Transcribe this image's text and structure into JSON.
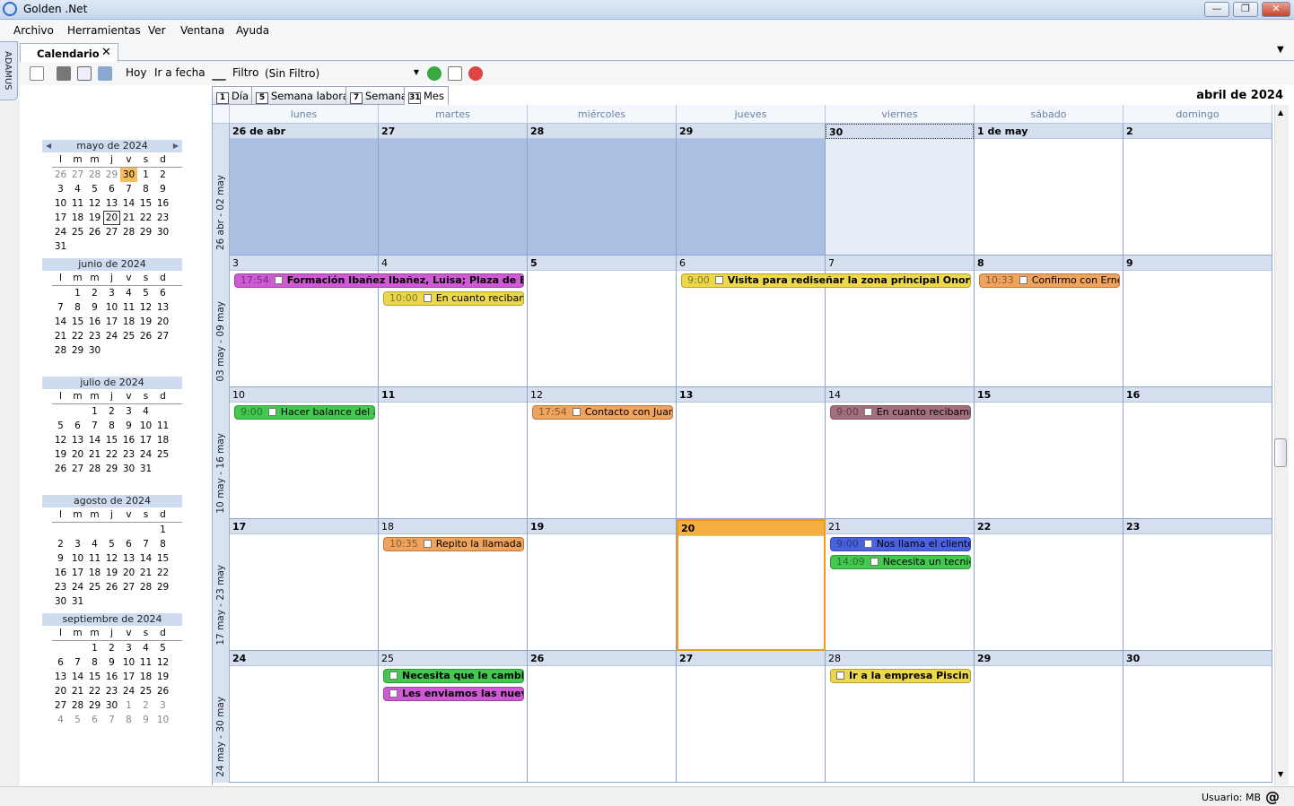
{
  "window": {
    "title": "Golden .Net",
    "min": "—",
    "max": "❐",
    "close": "✕"
  },
  "menu": [
    "Archivo",
    "Herramientas",
    "Ver",
    "Ventana",
    "Ayuda"
  ],
  "sidebar_label": "ADAMUS",
  "tab": {
    "label": "Calendario",
    "close": "✕",
    "dropdown": "▼"
  },
  "toolbar": {
    "today": "Hoy",
    "goto": "Ir a fecha",
    "filter_label": "Filtro",
    "filter_value": "(Sin Filtro)"
  },
  "view_tabs": [
    {
      "num": "1",
      "label": "Día"
    },
    {
      "num": "5",
      "label": "Semana laboral"
    },
    {
      "num": "7",
      "label": "Semana"
    },
    {
      "num": "31",
      "label": "Mes"
    }
  ],
  "period": "abril de 2024",
  "mini_calendars": [
    {
      "title": "mayo de 2024",
      "dow": [
        "l",
        "m",
        "m",
        "j",
        "v",
        "s",
        "d"
      ],
      "weeks": [
        [
          "26",
          "27",
          "28",
          "29",
          "30",
          "1",
          "2"
        ],
        [
          "3",
          "4",
          "5",
          "6",
          "7",
          "8",
          "9"
        ],
        [
          "10",
          "11",
          "12",
          "13",
          "14",
          "15",
          "16"
        ],
        [
          "17",
          "18",
          "19",
          "20",
          "21",
          "22",
          "23"
        ],
        [
          "24",
          "25",
          "26",
          "27",
          "28",
          "29",
          "30"
        ],
        [
          "31"
        ]
      ]
    },
    {
      "title": "junio de 2024",
      "dow": [
        "l",
        "m",
        "m",
        "j",
        "v",
        "s",
        "d"
      ],
      "weeks": [
        [
          "",
          "1",
          "2",
          "3",
          "4",
          "5",
          "6"
        ],
        [
          "7",
          "8",
          "9",
          "10",
          "11",
          "12",
          "13"
        ],
        [
          "14",
          "15",
          "16",
          "17",
          "18",
          "19",
          "20"
        ],
        [
          "21",
          "22",
          "23",
          "24",
          "25",
          "26",
          "27"
        ],
        [
          "28",
          "29",
          "30"
        ]
      ]
    },
    {
      "title": "julio de 2024",
      "dow": [
        "l",
        "m",
        "m",
        "j",
        "v",
        "s",
        "d"
      ],
      "weeks": [
        [
          "",
          "",
          "1",
          "2",
          "3",
          "4"
        ],
        [
          "5",
          "6",
          "7",
          "8",
          "9",
          "10",
          "11"
        ],
        [
          "12",
          "13",
          "14",
          "15",
          "16",
          "17",
          "18"
        ],
        [
          "19",
          "20",
          "21",
          "22",
          "23",
          "24",
          "25"
        ],
        [
          "26",
          "27",
          "28",
          "29",
          "30",
          "31"
        ]
      ]
    },
    {
      "title": "agosto de 2024",
      "dow": [
        "l",
        "m",
        "m",
        "j",
        "v",
        "s",
        "d"
      ],
      "weeks": [
        [
          "",
          "",
          "",
          "",
          "",
          "",
          "1"
        ],
        [
          "2",
          "3",
          "4",
          "5",
          "6",
          "7",
          "8"
        ],
        [
          "9",
          "10",
          "11",
          "12",
          "13",
          "14",
          "15"
        ],
        [
          "16",
          "17",
          "18",
          "19",
          "20",
          "21",
          "22"
        ],
        [
          "23",
          "24",
          "25",
          "26",
          "27",
          "28",
          "29"
        ],
        [
          "30",
          "31"
        ]
      ]
    },
    {
      "title": "septiembre de 2024",
      "dow": [
        "l",
        "m",
        "m",
        "j",
        "v",
        "s",
        "d"
      ],
      "weeks": [
        [
          "",
          "",
          "1",
          "2",
          "3",
          "4",
          "5"
        ],
        [
          "6",
          "7",
          "8",
          "9",
          "10",
          "11",
          "12"
        ],
        [
          "13",
          "14",
          "15",
          "16",
          "17",
          "18",
          "19"
        ],
        [
          "20",
          "21",
          "22",
          "23",
          "24",
          "25",
          "26"
        ],
        [
          "27",
          "28",
          "29",
          "30",
          "1",
          "2",
          "3"
        ],
        [
          "4",
          "5",
          "6",
          "7",
          "8",
          "9",
          "10"
        ]
      ]
    }
  ],
  "days_of_week": [
    "lunes",
    "martes",
    "miércoles",
    "jueves",
    "viernes",
    "sábado",
    "domingo"
  ],
  "weeks": [
    {
      "label": "26 abr - 02 may",
      "days": [
        "26 de abr",
        "27",
        "28",
        "29",
        "30",
        "1 de may",
        "2"
      ]
    },
    {
      "label": "03 may - 09 may",
      "days": [
        "3",
        "4",
        "5",
        "6",
        "7",
        "8",
        "9"
      ]
    },
    {
      "label": "10 may - 16 may",
      "days": [
        "10",
        "11",
        "12",
        "13",
        "14",
        "15",
        "16"
      ]
    },
    {
      "label": "17 may - 23 may",
      "days": [
        "17",
        "18",
        "19",
        "20",
        "21",
        "22",
        "23"
      ]
    },
    {
      "label": "24 may - 30 may",
      "days": [
        "24",
        "25",
        "26",
        "27",
        "28",
        "29",
        "30"
      ]
    }
  ],
  "events": [
    {
      "week": 1,
      "col": 0,
      "span": 2,
      "row": 0,
      "time": "17:54",
      "text": "Formación Ibañez Ibañez, Luisa;   Plaza de Esp",
      "color": "#d05ad6",
      "bold": true
    },
    {
      "week": 1,
      "col": 1,
      "span": 1,
      "row": 1,
      "time": "10:00",
      "text": "En cuanto recibam",
      "color": "#ecd84a"
    },
    {
      "week": 1,
      "col": 3,
      "span": 2,
      "row": 0,
      "time": "9:00",
      "text": "Visita para rediseñar la zona principal Onorio",
      "color": "#ecd84a",
      "bold": true
    },
    {
      "week": 1,
      "col": 5,
      "span": 1,
      "row": 0,
      "time": "10:33",
      "text": "Confirmo con Erne",
      "color": "#f0a35c"
    },
    {
      "week": 2,
      "col": 0,
      "span": 1,
      "row": 0,
      "time": "9:00",
      "text": "Hacer balance del a",
      "color": "#43c94f"
    },
    {
      "week": 2,
      "col": 2,
      "span": 1,
      "row": 0,
      "time": "17:54",
      "text": "Contacto con Juan",
      "color": "#f0a35c"
    },
    {
      "week": 2,
      "col": 4,
      "span": 1,
      "row": 0,
      "time": "9:00",
      "text": "En cuanto recibamo",
      "color": "#a5707d"
    },
    {
      "week": 3,
      "col": 1,
      "span": 1,
      "row": 0,
      "time": "10:35",
      "text": "Repito la llamada",
      "color": "#f0a35c"
    },
    {
      "week": 3,
      "col": 4,
      "span": 1,
      "row": 0,
      "time": "9:00",
      "text": "Nos llama el cliente",
      "color": "#4b62e0"
    },
    {
      "week": 3,
      "col": 4,
      "span": 1,
      "row": 1,
      "time": "14:09",
      "text": "Necesita un tecnic",
      "color": "#43c94f"
    },
    {
      "week": 4,
      "col": 1,
      "span": 1,
      "row": 0,
      "time": "",
      "text": "Necesita que le cambi",
      "color": "#43c94f",
      "bold": true
    },
    {
      "week": 4,
      "col": 1,
      "span": 1,
      "row": 1,
      "time": "",
      "text": "Les enviamos las nuev",
      "color": "#d05ad6",
      "bold": true
    },
    {
      "week": 4,
      "col": 4,
      "span": 1,
      "row": 0,
      "time": "",
      "text": "Ir a la empresa Piscin",
      "color": "#ecd84a",
      "bold": true
    }
  ],
  "status": {
    "user": "Usuario: MB",
    "at": "@"
  }
}
